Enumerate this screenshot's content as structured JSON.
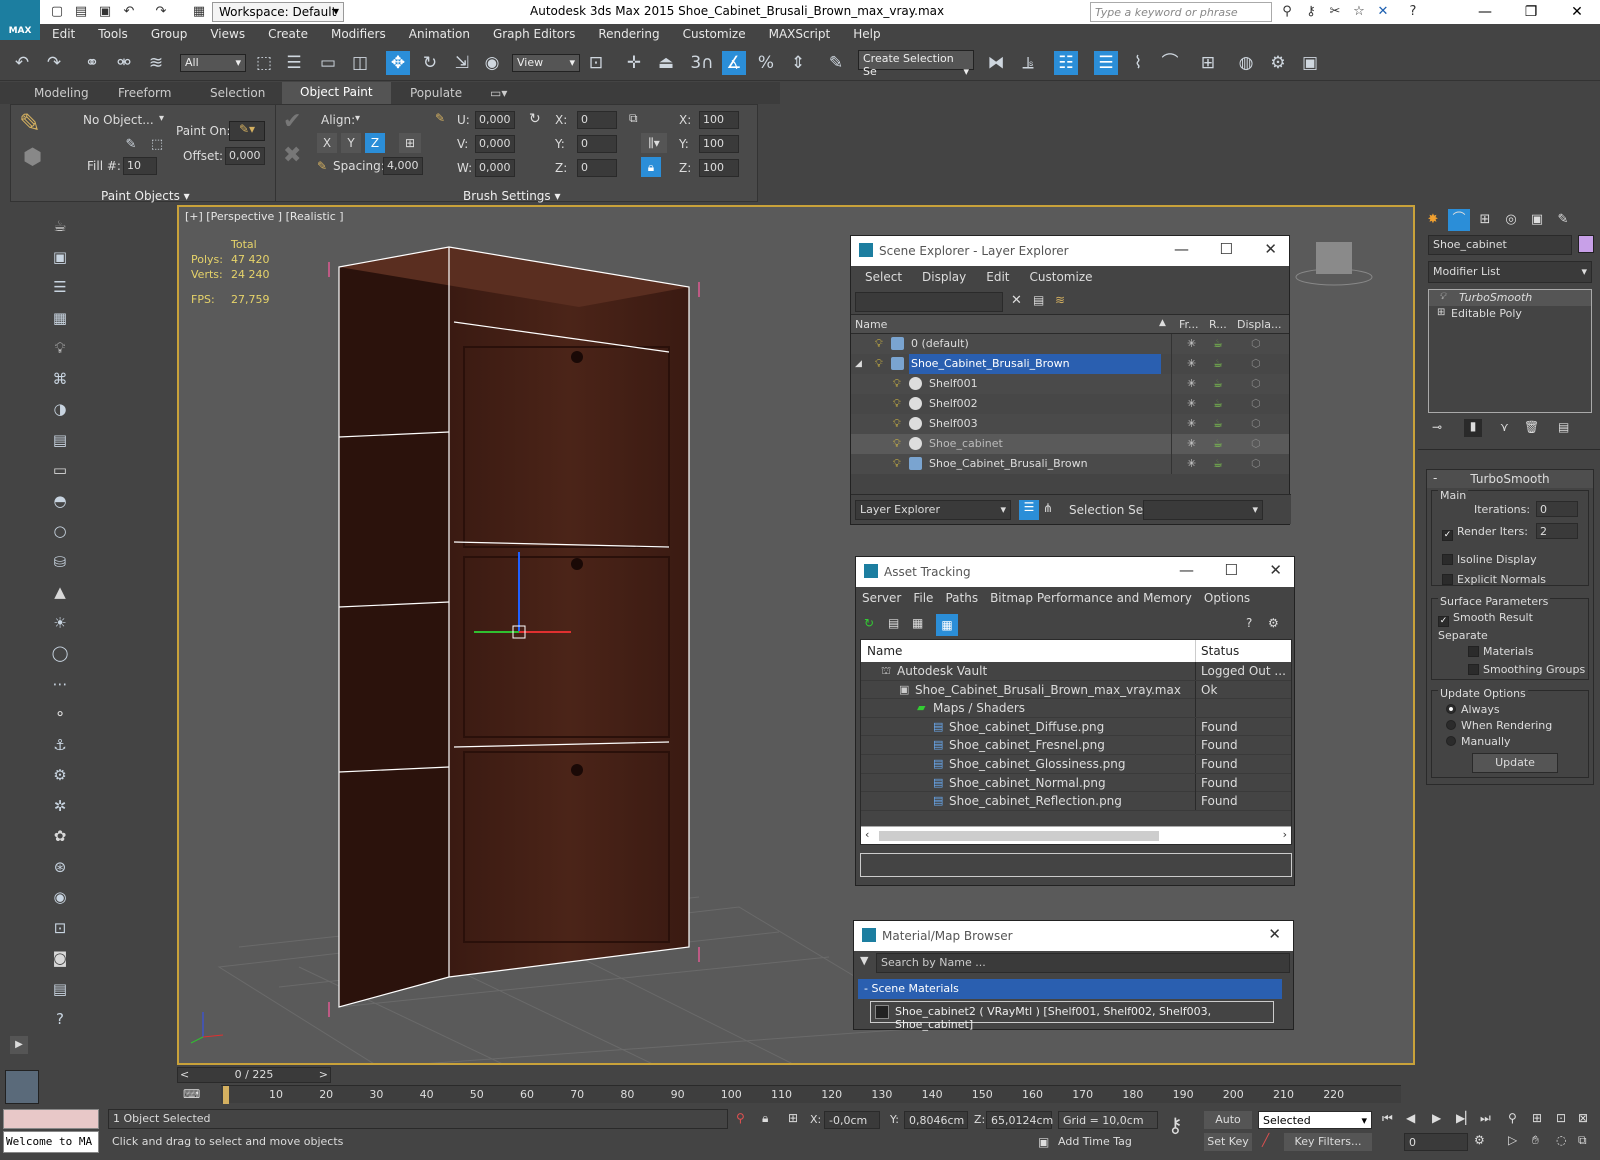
{
  "app": {
    "title": "Autodesk 3ds Max  2015    Shoe_Cabinet_Brusali_Brown_max_vray.max",
    "logo": "MAX",
    "workspace": "Workspace: Default",
    "search_placeholder": "Type a keyword or phrase"
  },
  "menu": [
    "Edit",
    "Tools",
    "Group",
    "Views",
    "Create",
    "Modifiers",
    "Animation",
    "Graph Editors",
    "Rendering",
    "Customize",
    "MAXScript",
    "Help"
  ],
  "toolbar": {
    "filter": "All",
    "ref_coord": "View",
    "selection_set": "Create Selection Se",
    "snap_num": "3"
  },
  "ribbon": {
    "tabs": [
      "Modeling",
      "Freeform",
      "Selection",
      "Object Paint",
      "Populate"
    ],
    "active_tab": "Object Paint",
    "no_object": "No Object...",
    "fill_label": "Fill #:",
    "fill_value": "10",
    "paint_on": "Paint On:",
    "offset": "Offset:",
    "offset_value": "0,000",
    "align": "Align:",
    "x": "X",
    "y": "Y",
    "z": "Z",
    "spacing": "Spacing:",
    "spacing_value": "4,000",
    "u": "U:",
    "v": "V:",
    "w": "W:",
    "uvw": "0,000",
    "xl": "X:",
    "yl": "Y:",
    "zl": "Z:",
    "xyz": "0",
    "sx": "100",
    "sy": "100",
    "sz": "100",
    "group_paint": "Paint Objects",
    "group_brush": "Brush Settings"
  },
  "viewport": {
    "label": "[+] [Perspective ] [Realistic ]",
    "stats_total": "Total",
    "polys_label": "Polys:",
    "polys": "47 420",
    "verts_label": "Verts:",
    "verts": "24 240",
    "fps_label": "FPS:",
    "fps": "27,759"
  },
  "scene_explorer": {
    "title": "Scene Explorer - Layer Explorer",
    "menu": [
      "Select",
      "Display",
      "Edit",
      "Customize"
    ],
    "cols": [
      "Name",
      "Fr...",
      "R...",
      "Displa..."
    ],
    "rows": [
      {
        "name": "0 (default)",
        "indent": 0,
        "selected": false
      },
      {
        "name": "Shoe_Cabinet_Brusali_Brown",
        "indent": 0,
        "selected": true
      },
      {
        "name": "Shelf001",
        "indent": 1,
        "selected": false
      },
      {
        "name": "Shelf002",
        "indent": 1,
        "selected": false
      },
      {
        "name": "Shelf003",
        "indent": 1,
        "selected": false
      },
      {
        "name": "Shoe_cabinet",
        "indent": 1,
        "selected": false,
        "highlight": true
      },
      {
        "name": "Shoe_Cabinet_Brusali_Brown",
        "indent": 1,
        "selected": false
      }
    ],
    "footer_mode": "Layer Explorer",
    "footer_selset": "Selection Set:"
  },
  "asset_tracking": {
    "title": "Asset Tracking",
    "menu": [
      "Server",
      "File",
      "Paths",
      "Bitmap Performance and Memory",
      "Options"
    ],
    "cols": [
      "Name",
      "Status"
    ],
    "rows": [
      {
        "name": "Autodesk Vault",
        "status": "Logged Out ..."
      },
      {
        "name": "Shoe_Cabinet_Brusali_Brown_max_vray.max",
        "status": "Ok"
      },
      {
        "name": "Maps / Shaders",
        "status": ""
      },
      {
        "name": "Shoe_cabinet_Diffuse.png",
        "status": "Found"
      },
      {
        "name": "Shoe_cabinet_Fresnel.png",
        "status": "Found"
      },
      {
        "name": "Shoe_cabinet_Glossiness.png",
        "status": "Found"
      },
      {
        "name": "Shoe_cabinet_Normal.png",
        "status": "Found"
      },
      {
        "name": "Shoe_cabinet_Reflection.png",
        "status": "Found"
      }
    ]
  },
  "material_browser": {
    "title": "Material/Map Browser",
    "search_placeholder": "Search by Name ...",
    "section": "- Scene Materials",
    "item": "Shoe_cabinet2  ( VRayMtl )  [Shelf001, Shelf002, Shelf003, Shoe_cabinet]"
  },
  "command_panel": {
    "object_name": "Shoe_cabinet",
    "modifier_list": "Modifier List",
    "stack": [
      "TurboSmooth",
      "Editable Poly"
    ],
    "rollout_title": "TurboSmooth",
    "main": "Main",
    "iterations_label": "Iterations:",
    "iterations": "0",
    "render_iters_label": "Render Iters:",
    "render_iters": "2",
    "isoline": "Isoline Display",
    "explicit": "Explicit Normals",
    "surface": "Surface Parameters",
    "smooth_result": "Smooth Result",
    "separate": "Separate",
    "materials": "Materials",
    "smoothing_groups": "Smoothing Groups",
    "update_options": "Update Options",
    "always": "Always",
    "when_rendering": "When Rendering",
    "manually": "Manually",
    "update": "Update"
  },
  "timeline": {
    "frame": "0 / 225",
    "ticks": [
      "10",
      "20",
      "30",
      "40",
      "50",
      "60",
      "70",
      "80",
      "90",
      "100",
      "110",
      "120",
      "130",
      "140",
      "150",
      "160",
      "170",
      "180",
      "190",
      "200",
      "210",
      "220"
    ]
  },
  "status": {
    "welcome": "Welcome to MA",
    "selected": "1 Object Selected",
    "prompt": "Click and drag to select and move objects",
    "x_label": "X:",
    "x": "-0,0cm",
    "y_label": "Y:",
    "y": "0,8046cm",
    "z_label": "Z:",
    "z": "65,0124cm",
    "grid": "Grid = 10,0cm",
    "auto_key": "Auto Key",
    "set_key": "Set Key",
    "key_mode": "Selected",
    "key_filters": "Key Filters...",
    "add_time_tag": "Add Time Tag",
    "frame": "0"
  }
}
